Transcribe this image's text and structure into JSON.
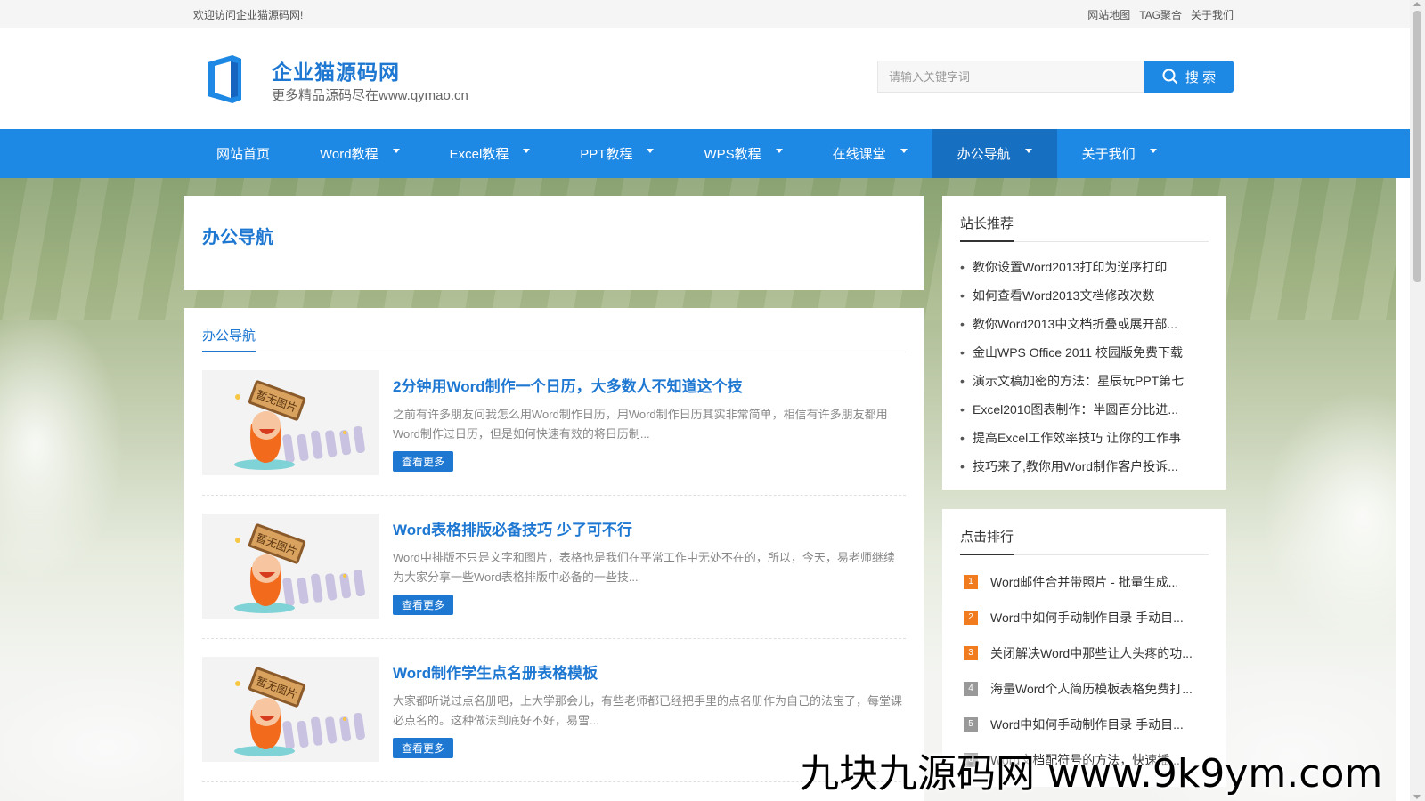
{
  "topbar": {
    "welcome": "欢迎访问企业猫源码网!",
    "links": [
      "网站地图",
      "TAG聚合",
      "关于我们"
    ]
  },
  "header": {
    "site_title": "企业猫源码网",
    "site_subtitle": "更多精品源码尽在www.qymao.cn",
    "search_placeholder": "请输入关键字词",
    "search_button": "搜 索"
  },
  "nav": {
    "items": [
      {
        "label": "网站首页",
        "has_dropdown": false
      },
      {
        "label": "Word教程",
        "has_dropdown": true
      },
      {
        "label": "Excel教程",
        "has_dropdown": true
      },
      {
        "label": "PPT教程",
        "has_dropdown": true
      },
      {
        "label": "WPS教程",
        "has_dropdown": true
      },
      {
        "label": "在线课堂",
        "has_dropdown": true
      },
      {
        "label": "办公导航",
        "has_dropdown": true,
        "active": true
      },
      {
        "label": "关于我们",
        "has_dropdown": true
      }
    ]
  },
  "category": {
    "title": "办公导航",
    "tab": "办公导航"
  },
  "articles": [
    {
      "title": "2分钟用Word制作一个日历，大多数人不知道这个技",
      "summary": "之前有许多朋友问我怎么用Word制作日历，用Word制作日历其实非常简单，相信有许多朋友都用Word制作过日历，但是如何快速有效的将日历制...",
      "more": "查看更多",
      "thumb_text": "暂无图片"
    },
    {
      "title": "Word表格排版必备技巧 少了可不行",
      "summary": "Word中排版不只是文字和图片，表格也是我们在平常工作中无处不在的，所以，今天，易老师继续为大家分享一些Word表格排版中必备的一些技...",
      "more": "查看更多",
      "thumb_text": "暂无图片"
    },
    {
      "title": "Word制作学生点名册表格模板",
      "summary": "大家都听说过点名册吧，上大学那会儿，有些老师都已经把手里的点名册作为自己的法宝了，每堂课必点名的。这种做法到底好不好，易雪...",
      "more": "查看更多",
      "thumb_text": "暂无图片"
    }
  ],
  "sidebar": {
    "recommend_title": "站长推荐",
    "recommend": [
      "教你设置Word2013打印为逆序打印",
      "如何查看Word2013文档修改次数",
      "教你Word2013中文档折叠或展开部...",
      "金山WPS Office 2011 校园版免费下载",
      "演示文稿加密的方法：星辰玩PPT第七",
      "Excel2010图表制作：半圆百分比进...",
      "提高Excel工作效率技巧 让你的工作事",
      "技巧来了,教你用Word制作客户投诉..."
    ],
    "ranking_title": "点击排行",
    "ranking": [
      {
        "num": "1",
        "title": "Word邮件合并带照片 - 批量生成..."
      },
      {
        "num": "2",
        "title": "Word中如何手动制作目录 手动目..."
      },
      {
        "num": "3",
        "title": "关闭解决Word中那些让人头疼的功..."
      },
      {
        "num": "4",
        "title": "海量Word个人简历模板表格免费打..."
      },
      {
        "num": "5",
        "title": "Word中如何手动制作目录 手动目..."
      },
      {
        "num": "6",
        "title": "Word文档配符号的方法，快速插..."
      }
    ]
  },
  "colors": {
    "brand": "#1e88e5",
    "nav_active": "#176fc1",
    "rank_top": "#f07c1f",
    "rank_other": "#999999"
  },
  "watermark": "九块九源码网 www.9k9ym.com"
}
